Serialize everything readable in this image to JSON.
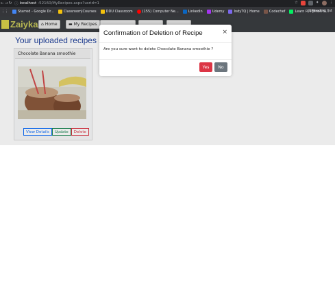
{
  "browser": {
    "url_host": "localhost",
    "url_rest": ":52160/MyRecipes.aspx?usrid=1",
    "bookmarks": [
      {
        "label": "Starred - Google Dr...",
        "color": "#4285f4"
      },
      {
        "label": "Classroom|Courses",
        "color": "#f4c20d"
      },
      {
        "label": "DDU Classroom",
        "color": "#f4c20d"
      },
      {
        "label": "(155) Computer Ne...",
        "color": "#ff0000"
      },
      {
        "label": "LinkedIn",
        "color": "#0a66c2"
      },
      {
        "label": "Udemy",
        "color": "#a435f0"
      },
      {
        "label": "IndyTQ | Home",
        "color": "#7b68ee"
      },
      {
        "label": "Codechef",
        "color": "#795548"
      },
      {
        "label": "Learn R, Python &...",
        "color": "#03ef62"
      }
    ],
    "more_label": "»",
    "reading_list": "Reading list"
  },
  "navbar": {
    "brand": "Zaiyka",
    "home": "Home",
    "my_recipes": "My Recipes"
  },
  "page": {
    "heading": "Your uploaded recipes"
  },
  "card": {
    "title": "Chocolate Banana smoothie",
    "view": "View Details",
    "update": "Update",
    "delete": "Delete"
  },
  "modal": {
    "title": "Confirmation of Deletion of Recipe",
    "close": "×",
    "body": "Are you sure want to delete Chocolate Banana smoothie ?",
    "yes": "Yes",
    "no": "No"
  },
  "colors": {
    "yes": "#dc3545",
    "no": "#6c757d",
    "heading": "#1e3f9a",
    "brand": "#c8c85a"
  }
}
